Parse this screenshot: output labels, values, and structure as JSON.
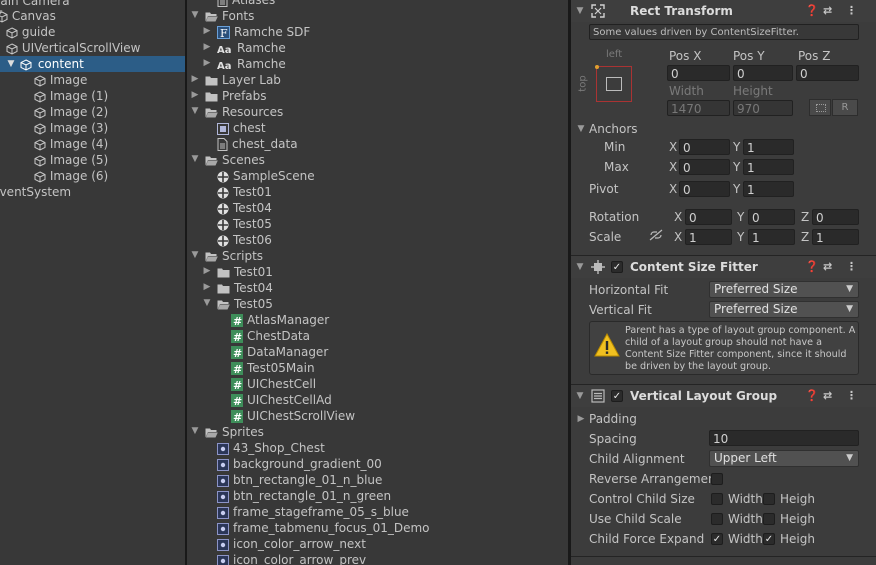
{
  "hierarchy": {
    "items": [
      {
        "label": "Main Camera"
      },
      {
        "label": "Canvas"
      },
      {
        "label": "guide"
      },
      {
        "label": "UIVerticalScrollView"
      },
      {
        "label": "content"
      },
      {
        "label": "Image"
      },
      {
        "label": "Image (1)"
      },
      {
        "label": "Image (2)"
      },
      {
        "label": "Image (3)"
      },
      {
        "label": "Image (4)"
      },
      {
        "label": "Image (5)"
      },
      {
        "label": "Image (6)"
      },
      {
        "label": "EventSystem"
      }
    ]
  },
  "project": {
    "items": [
      {
        "label": "Atlases"
      },
      {
        "label": "Fonts"
      },
      {
        "label": "Ramche SDF"
      },
      {
        "label": "Ramche"
      },
      {
        "label": "Ramche"
      },
      {
        "label": "Layer Lab"
      },
      {
        "label": "Prefabs"
      },
      {
        "label": "Resources"
      },
      {
        "label": "chest"
      },
      {
        "label": "chest_data"
      },
      {
        "label": "Scenes"
      },
      {
        "label": "SampleScene"
      },
      {
        "label": "Test01"
      },
      {
        "label": "Test04"
      },
      {
        "label": "Test05"
      },
      {
        "label": "Test06"
      },
      {
        "label": "Scripts"
      },
      {
        "label": "Test01"
      },
      {
        "label": "Test04"
      },
      {
        "label": "Test05"
      },
      {
        "label": "AtlasManager"
      },
      {
        "label": "ChestData"
      },
      {
        "label": "DataManager"
      },
      {
        "label": "Test05Main"
      },
      {
        "label": "UIChestCell"
      },
      {
        "label": "UIChestCellAd"
      },
      {
        "label": "UIChestScrollView"
      },
      {
        "label": "Sprites"
      },
      {
        "label": "43_Shop_Chest"
      },
      {
        "label": "background_gradient_00"
      },
      {
        "label": "btn_rectangle_01_n_blue"
      },
      {
        "label": "btn_rectangle_01_n_green"
      },
      {
        "label": "frame_stageframe_05_s_blue"
      },
      {
        "label": "frame_tabmenu_focus_01_Demo"
      },
      {
        "label": "icon_color_arrow_next"
      },
      {
        "label": "icon_color_arrow_prev"
      }
    ]
  },
  "inspector": {
    "rect": {
      "title": "Rect Transform",
      "driven_note": "Some values driven by ContentSizeFitter.",
      "anchor_h": "left",
      "anchor_v": "top",
      "pos_x_label": "Pos X",
      "pos_y_label": "Pos Y",
      "pos_z_label": "Pos Z",
      "pos_x": "0",
      "pos_y": "0",
      "pos_z": "0",
      "width_label": "Width",
      "height_label": "Height",
      "width": "1470",
      "height": "970",
      "r_btn": "R",
      "anchors_label": "Anchors",
      "min_label": "Min",
      "max_label": "Max",
      "min_x": "0",
      "min_y": "1",
      "max_x": "0",
      "max_y": "1",
      "pivot_label": "Pivot",
      "pivot_x": "0",
      "pivot_y": "1",
      "rotation_label": "Rotation",
      "rot_x": "0",
      "rot_y": "0",
      "rot_z": "0",
      "scale_label": "Scale",
      "scale_x": "1",
      "scale_y": "1",
      "scale_z": "1",
      "x": "X",
      "y": "Y",
      "z": "Z"
    },
    "csf": {
      "title": "Content Size Fitter",
      "hfit_label": "Horizontal Fit",
      "hfit": "Preferred Size",
      "vfit_label": "Vertical Fit",
      "vfit": "Preferred Size",
      "warning": "Parent has a type of layout group component. A child of a layout group should not have a Content Size Fitter component, since it should be driven by the layout group."
    },
    "vlg": {
      "title": "Vertical Layout Group",
      "padding_label": "Padding",
      "spacing_label": "Spacing",
      "spacing": "10",
      "align_label": "Child Alignment",
      "align": "Upper Left",
      "reverse_label": "Reverse Arrangement",
      "ccs_label": "Control Child Size",
      "ucs_label": "Use Child Scale",
      "cfe_label": "Child Force Expand",
      "width": "Width",
      "height": "Heigh"
    }
  }
}
